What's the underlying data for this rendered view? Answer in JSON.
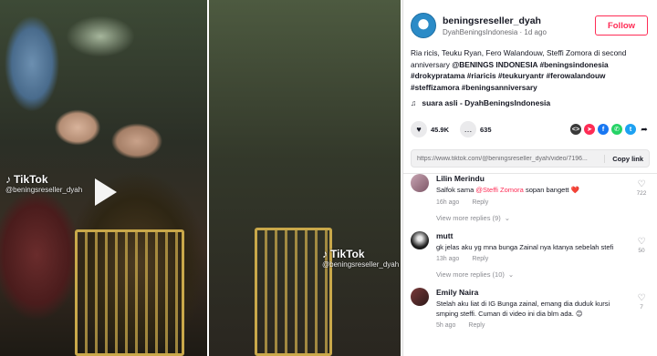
{
  "watermark": {
    "brand": "TikTok",
    "handle": "@beningsreseller_dyah"
  },
  "post": {
    "username": "beningsreseller_dyah",
    "display_name": "DyahBeningsIndonesia",
    "separator": "·",
    "time": "1d ago",
    "follow_label": "Follow",
    "caption_text": "Ria ricis, Teuku Ryan, Fero Walandouw, Steffi Zomora di second anniversary ",
    "caption_tags": "@BENINGS INDONESIA #beningsindonesia #drokypratama #riaricis #teukuryantr #ferowalandouw #steffizamora #beningsanniversary",
    "music": "suara asli - DyahBeningsIndonesia",
    "likes": "45.9K",
    "comments_count": "635",
    "link": "https://www.tiktok.com/@beningsreseller_dyah/video/7196...",
    "copy_label": "Copy link"
  },
  "colors": {
    "accent": "#fe2c55",
    "whatsapp": "#25d366",
    "facebook": "#1877f2",
    "twitter": "#1da1f2",
    "embed": "#3a3a3a",
    "send": "#fe2c55"
  },
  "comments": [
    {
      "name": "Lilin Merindu",
      "text_before": "Salfok sama ",
      "mention": "@Steffi Zomora",
      "text_after": " sopan bangett ❤️",
      "time": "16h ago",
      "reply": "Reply",
      "likes": "722",
      "more": "View more replies (9)"
    },
    {
      "name": "mutt",
      "text": "gk jelas aku yg mna bunga Zainal nya ktanya sebelah stefi",
      "time": "13h ago",
      "reply": "Reply",
      "likes": "50",
      "more": "View more replies (10)"
    },
    {
      "name": "Emily Naira",
      "text": "Stelah aku liat di IG Bunga zainal, emang dia duduk kursi smping steffi. Cuman di video ini dia blm ada. 😊",
      "time": "5h ago",
      "reply": "Reply",
      "likes": "7"
    }
  ]
}
